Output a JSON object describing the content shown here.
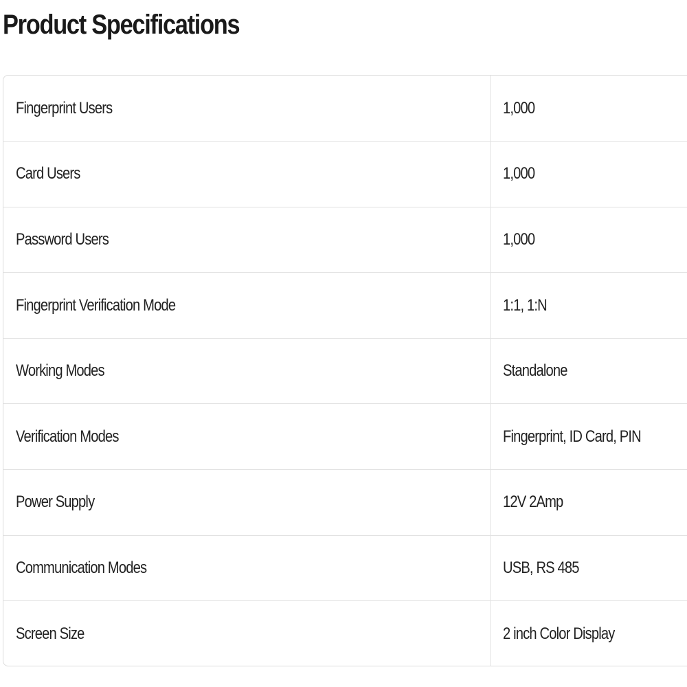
{
  "page": {
    "title": "Product Specifications"
  },
  "specs": [
    {
      "label": "Fingerprint Users",
      "value": "1,000"
    },
    {
      "label": "Card Users",
      "value": "1,000"
    },
    {
      "label": "Password Users",
      "value": "1,000"
    },
    {
      "label": "Fingerprint Verification Mode",
      "value": "1:1, 1:N"
    },
    {
      "label": "Working Modes",
      "value": "Standalone"
    },
    {
      "label": "Verification Modes",
      "value": "Fingerprint, ID Card, PIN"
    },
    {
      "label": "Power Supply",
      "value": "12V 2Amp"
    },
    {
      "label": "Communication Modes",
      "value": "USB, RS 485"
    },
    {
      "label": "Screen Size",
      "value": "2 inch Color Display"
    }
  ],
  "colors": {
    "text": "#222222",
    "border": "#e2e2e2",
    "background": "#ffffff"
  }
}
